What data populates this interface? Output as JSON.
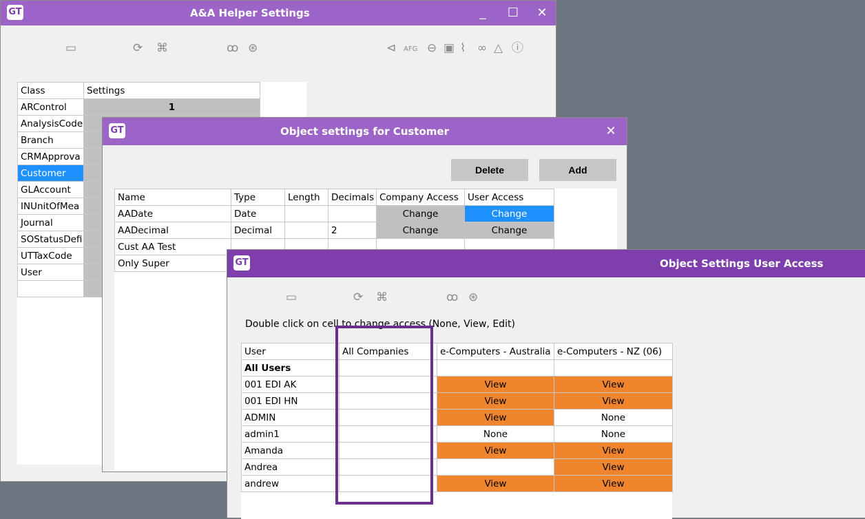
{
  "main_window": {
    "logo": "GT",
    "title": "A&A Helper Settings",
    "controls": {
      "minimize": "_",
      "maximize": "☐",
      "close": "✕"
    },
    "toolbar_right_label": "AFG",
    "grid": {
      "headers": [
        "Class",
        "Settings"
      ],
      "rows": [
        {
          "class": "ARControl",
          "settings": "1"
        },
        {
          "class": "AnalysisCode",
          "settings": ""
        },
        {
          "class": "Branch",
          "settings": ""
        },
        {
          "class": "CRMApprova",
          "settings": ""
        },
        {
          "class": "Customer",
          "settings": ""
        },
        {
          "class": "GLAccount",
          "settings": ""
        },
        {
          "class": "INUnitOfMea",
          "settings": ""
        },
        {
          "class": "Journal",
          "settings": ""
        },
        {
          "class": "SOStatusDefi",
          "settings": ""
        },
        {
          "class": "UTTaxCode",
          "settings": ""
        },
        {
          "class": "User",
          "settings": ""
        }
      ]
    }
  },
  "object_window": {
    "logo": "GT",
    "title": "Object settings for Customer",
    "close": "✕",
    "delete_label": "Delete",
    "add_label": "Add",
    "grid": {
      "headers": [
        "Name",
        "Type",
        "Length",
        "Decimals",
        "Company Access",
        "User Access"
      ],
      "rows": [
        {
          "name": "AADate",
          "type": "Date",
          "length": "",
          "decimals": "",
          "company": "Change",
          "user": "Change"
        },
        {
          "name": "AADecimal",
          "type": "Decimal",
          "length": "",
          "decimals": "2",
          "company": "Change",
          "user": "Change"
        },
        {
          "name": "Cust AA Test",
          "type": "",
          "length": "",
          "decimals": "",
          "company": "",
          "user": ""
        },
        {
          "name": "Only Super",
          "type": "",
          "length": "",
          "decimals": "",
          "company": "",
          "user": ""
        }
      ]
    }
  },
  "access_window": {
    "logo": "GT",
    "title": "Object Settings User Access",
    "instruction": "Double click on cell to change access (None, View, Edit)",
    "grid": {
      "headers": [
        "User",
        "All Companies",
        "e-Computers - Australia",
        "e-Computers - NZ (06)"
      ],
      "rows": [
        {
          "user": "All Users",
          "all": "",
          "au": "",
          "nz": ""
        },
        {
          "user": "001 EDI AK",
          "all": "",
          "au": "View",
          "nz": "View"
        },
        {
          "user": "001 EDI HN",
          "all": "",
          "au": "View",
          "nz": "View"
        },
        {
          "user": "ADMIN",
          "all": "",
          "au": "View",
          "nz": "None"
        },
        {
          "user": "admin1",
          "all": "",
          "au": "None",
          "nz": "None"
        },
        {
          "user": "Amanda",
          "all": "",
          "au": "View",
          "nz": "View"
        },
        {
          "user": "Andrea",
          "all": "",
          "au": "",
          "nz": "View"
        },
        {
          "user": "andrew",
          "all": "",
          "au": "View",
          "nz": "View"
        }
      ]
    }
  },
  "colors": {
    "title_light": "#9c64c6",
    "title_dark": "#7e3fad",
    "orange": "#f0852d",
    "select_blue": "#1e90ff",
    "highlight": "#6b2d8f"
  }
}
